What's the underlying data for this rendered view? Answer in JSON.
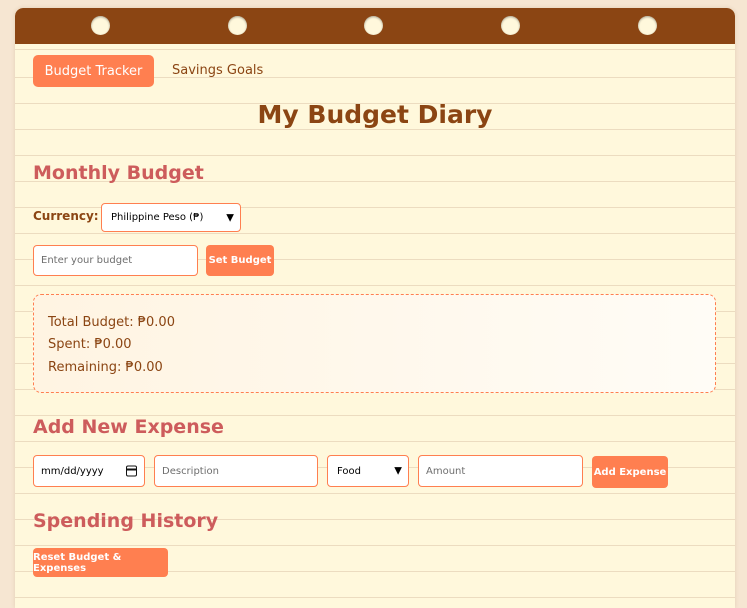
{
  "tabs": {
    "budget_tracker": "Budget Tracker",
    "savings_goals": "Savings Goals"
  },
  "page_title": "My Budget Diary",
  "monthly_budget": {
    "heading": "Monthly Budget",
    "currency_label": "Currency:",
    "currency_selected": "Philippine Peso (₱)",
    "budget_placeholder": "Enter your budget",
    "set_budget_label": "Set Budget"
  },
  "summary": {
    "total_budget": "Total Budget: ₱0.00",
    "spent": "Spent: ₱0.00",
    "remaining": "Remaining: ₱0.00"
  },
  "add_expense": {
    "heading": "Add New Expense",
    "date_placeholder": "mm/dd/yyyy",
    "description_placeholder": "Description",
    "category_selected": "Food",
    "amount_placeholder": "Amount",
    "add_label": "Add Expense"
  },
  "history": {
    "heading": "Spending History",
    "reset_label": "Reset Budget & Expenses"
  },
  "colors": {
    "accent": "#ff7f50",
    "binding": "#8b4513",
    "heading": "#cd5c5c",
    "paper": "#fff8dc",
    "background": "#f6e6d2"
  },
  "icons": {
    "date": "calendar-icon",
    "dropdown": "chevron-down-icon"
  }
}
